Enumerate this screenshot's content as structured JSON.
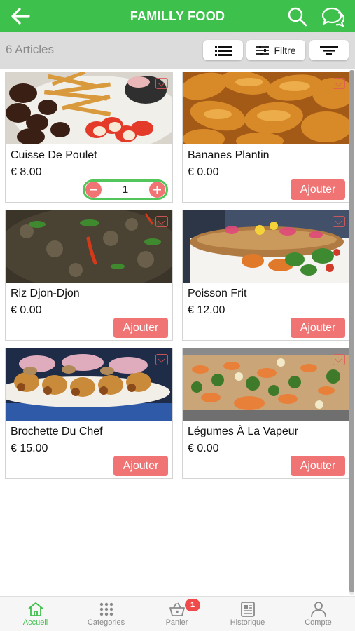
{
  "header": {
    "title": "FAMILLY FOOD",
    "back_icon": "arrow-left-icon",
    "search_icon": "search-icon",
    "chat_icon": "chat-bubbles-icon"
  },
  "toolbar": {
    "article_count": "6 Articles",
    "list_view_icon": "list-icon",
    "filter_label": "Filtre",
    "filter_icon": "sliders-icon",
    "sort_icon": "sort-lines-icon"
  },
  "products": [
    {
      "name": "Cuisse De Poulet",
      "price": "€ 8.00",
      "in_cart": true,
      "quantity": "1"
    },
    {
      "name": "Bananes Plantin",
      "price": "€ 0.00",
      "in_cart": false,
      "button": "Ajouter"
    },
    {
      "name": "Riz Djon-Djon",
      "price": "€ 0.00",
      "in_cart": false,
      "button": "Ajouter"
    },
    {
      "name": "Poisson Frit",
      "price": "€ 12.00",
      "in_cart": false,
      "button": "Ajouter"
    },
    {
      "name": "Brochette Du Chef",
      "price": "€ 15.00",
      "in_cart": false,
      "button": "Ajouter"
    },
    {
      "name": "Légumes À La Vapeur",
      "price": "€ 0.00",
      "in_cart": false,
      "button": "Ajouter"
    }
  ],
  "bottom_nav": {
    "items": [
      {
        "label": "Accueil",
        "icon": "home-icon",
        "active": true
      },
      {
        "label": "Categories",
        "icon": "grid-dots-icon",
        "active": false
      },
      {
        "label": "Panier",
        "icon": "basket-icon",
        "active": false,
        "badge": "1"
      },
      {
        "label": "Historique",
        "icon": "receipt-icon",
        "active": false
      },
      {
        "label": "Compte",
        "icon": "user-icon",
        "active": false
      }
    ]
  },
  "colors": {
    "primary_green": "#3ec14c",
    "add_button": "#f07474",
    "badge": "#ef4b4b",
    "toolbar_bg": "#dcdcdc"
  }
}
